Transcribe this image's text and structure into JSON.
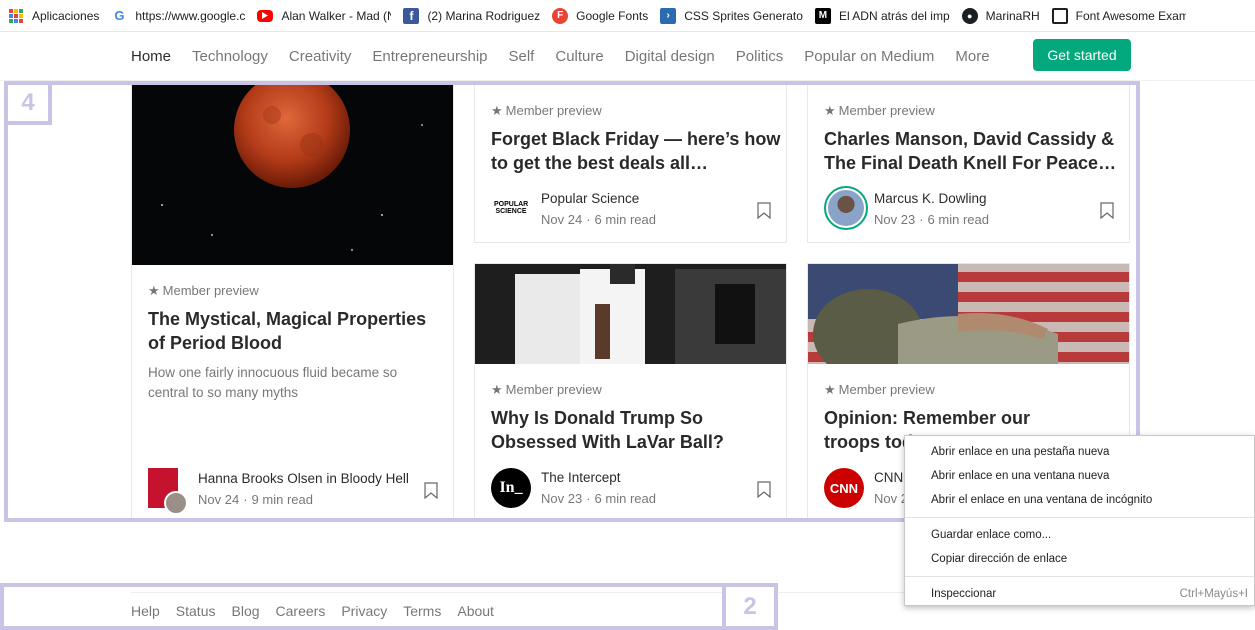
{
  "bookmarks": [
    {
      "label": "Aplicaciones",
      "icon": "apps-grid-icon"
    },
    {
      "label": "https://www.google.c",
      "icon": "google-icon"
    },
    {
      "label": "Alan Walker - Mad (N",
      "icon": "youtube-icon"
    },
    {
      "label": "(2) Marina Rodriguez",
      "icon": "facebook-icon"
    },
    {
      "label": "Google Fonts",
      "icon": "google-fonts-icon"
    },
    {
      "label": "CSS Sprites Generato",
      "icon": "css-sprites-icon"
    },
    {
      "label": "El ADN atrás del imp",
      "icon": "medium-icon"
    },
    {
      "label": "MarinaRH",
      "icon": "github-icon"
    },
    {
      "label": "Font Awesome Exam",
      "icon": "page-icon"
    }
  ],
  "nav": {
    "items": [
      "Home",
      "Technology",
      "Creativity",
      "Entrepreneurship",
      "Self",
      "Culture",
      "Digital design",
      "Politics",
      "Popular on Medium",
      "More"
    ],
    "cta": "Get started",
    "accent_color": "#03a87c"
  },
  "cards": {
    "preview_label": "Member preview",
    "period_blood": {
      "title": "The Mystical, Magical Properties of Period Blood",
      "subtitle": "How one fairly innocuous fluid became so central to so many myths",
      "author": "Hanna Brooks Olsen in Bloody Hell",
      "date": "Nov 24",
      "read_time": "9 min read"
    },
    "black_friday": {
      "title": "Forget Black Friday — here’s how to get the best deals all…",
      "author": "Popular Science",
      "avatar_text": "POPULAR SCIENCE",
      "date": "Nov 24",
      "read_time": "6 min read"
    },
    "manson": {
      "title": "Charles Manson, David Cassidy & The Final Death Knell For Peace…",
      "author": "Marcus K. Dowling",
      "date": "Nov 23",
      "read_time": "6 min read"
    },
    "trump": {
      "title": "Why Is Donald Trump So Obsessed With LaVar Ball?",
      "author": "The Intercept",
      "avatar_text": "In_",
      "date": "Nov 23",
      "read_time": "6 min read"
    },
    "troops": {
      "title": "Opinion: Remember our troops tod",
      "author": "CNN",
      "avatar_text": "CNN",
      "date": "Nov 2"
    }
  },
  "annotations": {
    "cards_tag": "4",
    "footer_tag": "2",
    "color": "#c9c3e6"
  },
  "footer": {
    "links": [
      "Help",
      "Status",
      "Blog",
      "Careers",
      "Privacy",
      "Terms",
      "About"
    ]
  },
  "context_menu": {
    "items": [
      "Abrir enlace en una pestaña nueva",
      "Abrir enlace en una ventana nueva",
      "Abrir el enlace en una ventana de incógnito",
      "Guardar enlace como...",
      "Copiar dirección de enlace",
      "Inspeccionar"
    ],
    "inspect_shortcut": "Ctrl+Mayús+I"
  }
}
